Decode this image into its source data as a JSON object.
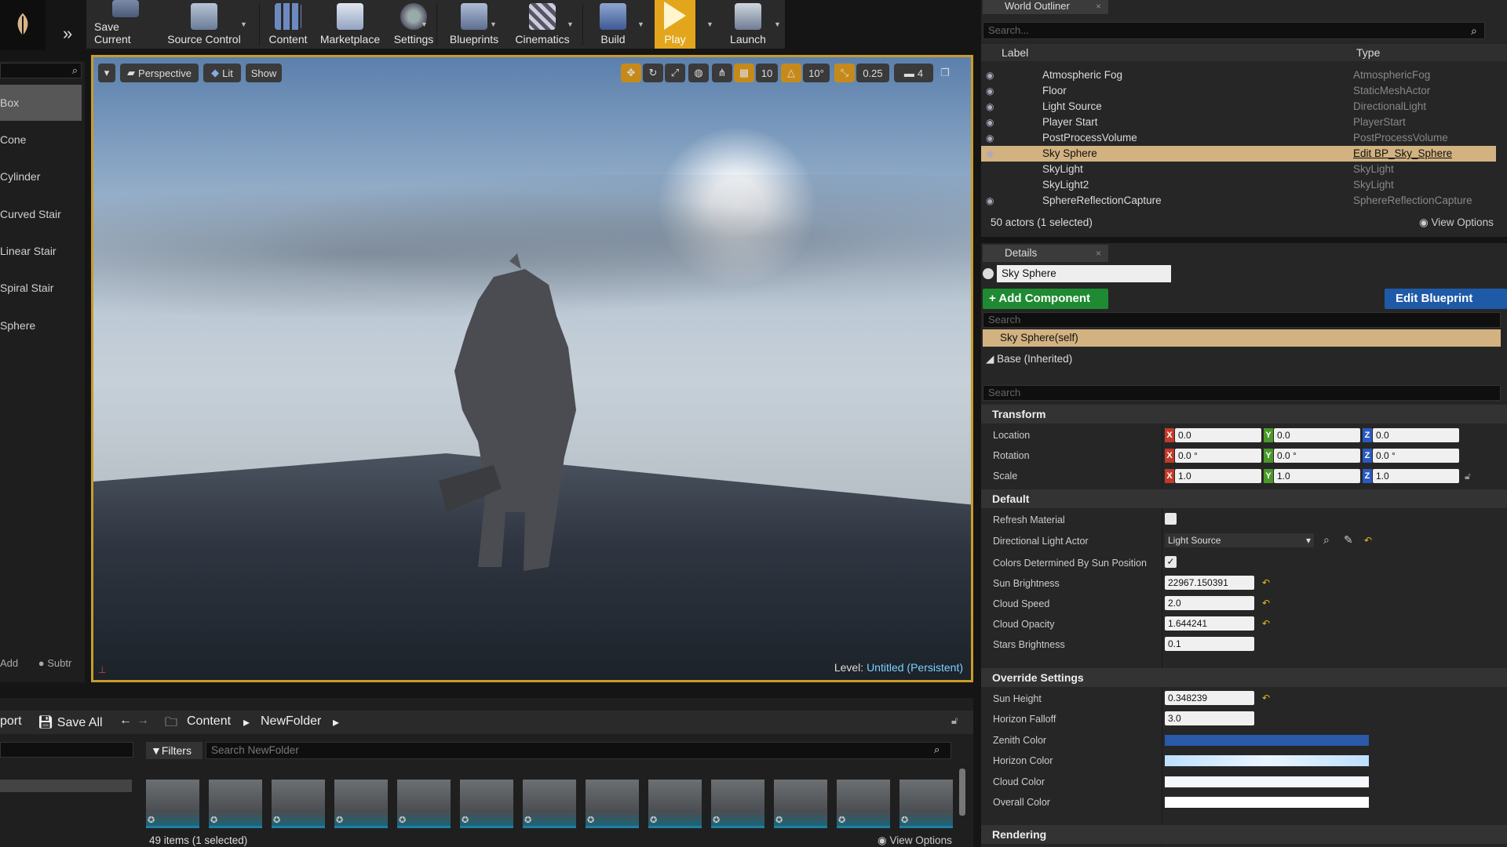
{
  "toolbar": {
    "buttons": [
      {
        "label": "Save Current"
      },
      {
        "label": "Source Control"
      },
      {
        "label": "Content"
      },
      {
        "label": "Marketplace"
      },
      {
        "label": "Settings"
      },
      {
        "label": "Blueprints"
      },
      {
        "label": "Cinematics"
      },
      {
        "label": "Build"
      },
      {
        "label": "Play"
      },
      {
        "label": "Launch"
      }
    ]
  },
  "modes": {
    "items": [
      "Box",
      "Cone",
      "Cylinder",
      "Curved Stair",
      "Linear Stair",
      "Spiral Stair",
      "Sphere"
    ],
    "bottom_add": "Add",
    "bottom_subtract": "Subtr"
  },
  "viewport": {
    "perspective": "Perspective",
    "lit": "Lit",
    "show": "Show",
    "grid_snap": "10",
    "rot_snap": "10°",
    "scale_snap": "0.25",
    "cam_speed": "4",
    "level_label": "Level:",
    "level_name": "Untitled (Persistent)"
  },
  "outliner": {
    "tab": "World Outliner",
    "search_placeholder": "Search...",
    "col_label": "Label",
    "col_type": "Type",
    "rows": [
      {
        "label": "Atmospheric Fog",
        "type": "AtmosphericFog"
      },
      {
        "label": "Floor",
        "type": "StaticMeshActor"
      },
      {
        "label": "Light Source",
        "type": "DirectionalLight"
      },
      {
        "label": "Player Start",
        "type": "PlayerStart"
      },
      {
        "label": "PostProcessVolume",
        "type": "PostProcessVolume"
      },
      {
        "label": "Sky Sphere",
        "type": "Edit BP_Sky_Sphere"
      },
      {
        "label": "SkyLight",
        "type": "SkyLight"
      },
      {
        "label": "SkyLight2",
        "type": "SkyLight"
      },
      {
        "label": "SphereReflectionCapture",
        "type": "SphereReflectionCapture"
      }
    ],
    "footer": "50 actors (1 selected)",
    "view_options": "View Options"
  },
  "details": {
    "tab": "Details",
    "object_name": "Sky Sphere",
    "add_component": "+ Add Component",
    "edit_blueprint": "Edit Blueprint",
    "search_placeholder": "Search",
    "component_self": "Sky Sphere(self)",
    "component_base": "Base (Inherited)",
    "transform": {
      "title": "Transform",
      "location_label": "Location",
      "rotation_label": "Rotation",
      "scale_label": "Scale",
      "location": [
        "0.0",
        "0.0",
        "0.0"
      ],
      "rotation": [
        "0.0 °",
        "0.0 °",
        "0.0 °"
      ],
      "scale": [
        "1.0",
        "1.0",
        "1.0"
      ]
    },
    "default": {
      "title": "Default",
      "refresh_material": "Refresh Material",
      "directional_light_actor": "Directional Light Actor",
      "directional_light_value": "Light Source",
      "colors_by_sun": "Colors Determined By Sun Position",
      "sun_brightness": "Sun Brightness",
      "sun_brightness_value": "22967.150391",
      "cloud_speed": "Cloud Speed",
      "cloud_speed_value": "2.0",
      "cloud_opacity": "Cloud Opacity",
      "cloud_opacity_value": "1.644241",
      "stars_brightness": "Stars Brightness",
      "stars_brightness_value": "0.1"
    },
    "override": {
      "title": "Override Settings",
      "sun_height": "Sun Height",
      "sun_height_value": "0.348239",
      "horizon_falloff": "Horizon Falloff",
      "horizon_falloff_value": "3.0",
      "zenith_color": "Zenith Color",
      "horizon_color": "Horizon Color",
      "cloud_color": "Cloud Color",
      "overall_color": "Overall Color"
    },
    "rendering_title": "Rendering"
  },
  "content_browser": {
    "import": "port",
    "save_all": "Save All",
    "path_root": "Content",
    "path_folder": "NewFolder",
    "filters": "Filters",
    "search_placeholder": "Search NewFolder",
    "footer": "49 items (1 selected)",
    "view_options": "View Options"
  },
  "colors": {
    "selection": "#d2b281",
    "add_component": "#1e8a32",
    "edit_blueprint": "#1f5aa8",
    "zenith": "#2a5aa8",
    "horizon": "#cfe8ff",
    "viewport_border": "#c99b2a"
  }
}
